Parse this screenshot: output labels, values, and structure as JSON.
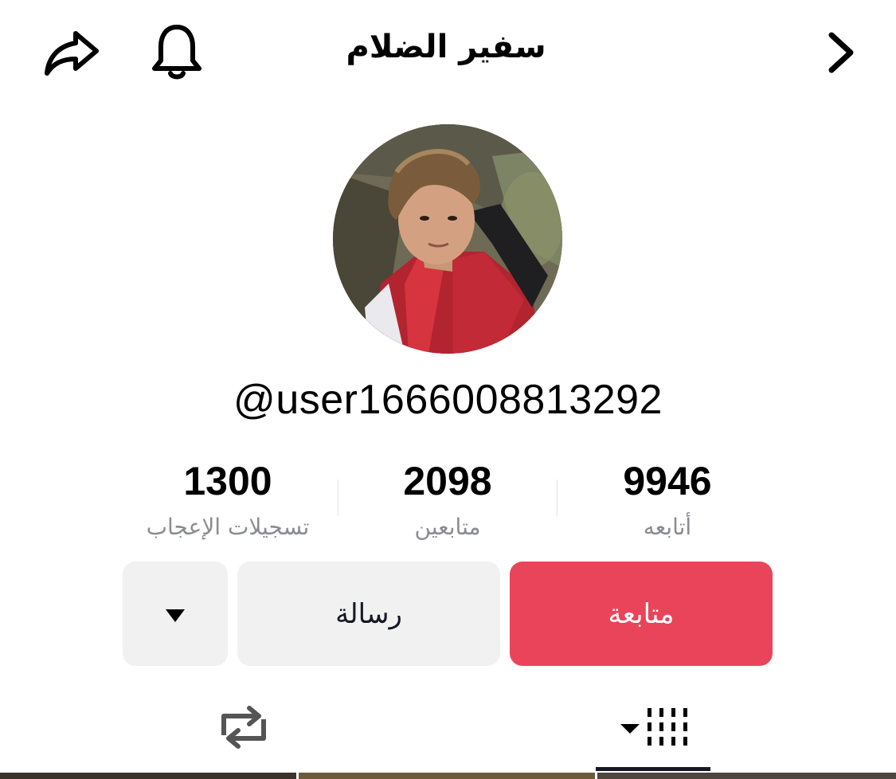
{
  "header": {
    "title": "سفير الضلام",
    "icons": [
      "share-icon",
      "bell-icon",
      "chevron-right-icon"
    ]
  },
  "profile": {
    "username": "@user1666008813292"
  },
  "stats": {
    "following": {
      "value": "9946",
      "label": "أتابعه"
    },
    "followers": {
      "value": "2098",
      "label": "متابعين"
    },
    "likes": {
      "value": "1300",
      "label": "تسجيلات الإعجاب"
    }
  },
  "actions": {
    "follow_label": "متابعة",
    "message_label": "رسالة",
    "more_icon": "caret-down-icon"
  },
  "tabs": {
    "videos_icon": "grid-filter-icon",
    "reposts_icon": "repost-icon",
    "active": "videos"
  },
  "colors": {
    "follow": "#ea445a",
    "button_secondary": "#f1f1f2",
    "text_secondary": "#8a8b91",
    "text_primary": "#161823"
  }
}
